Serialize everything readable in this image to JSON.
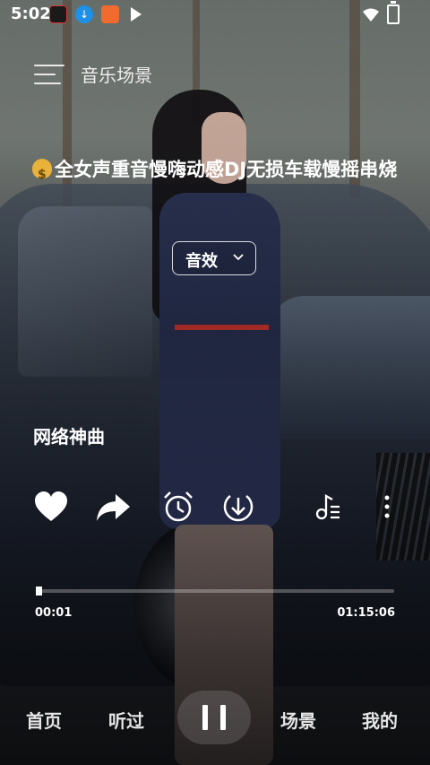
{
  "status_bar": {
    "time": "5:02"
  },
  "header": {
    "title": "音乐场景"
  },
  "song": {
    "title": "全女声重音慢嗨动感DJ无损车载慢摇串烧",
    "artist": "网络神曲"
  },
  "sound_effect": {
    "label": "音效"
  },
  "player": {
    "current_time": "00:01",
    "total_time": "01:15:06",
    "progress": 0.0002
  },
  "actions": [
    "heart-icon",
    "share-icon",
    "alarm-clock-icon",
    "download-icon",
    "playlist-icon",
    "more-icon"
  ],
  "nav": {
    "home": "首页",
    "history": "听过",
    "scene": "场景",
    "mine": "我的"
  }
}
